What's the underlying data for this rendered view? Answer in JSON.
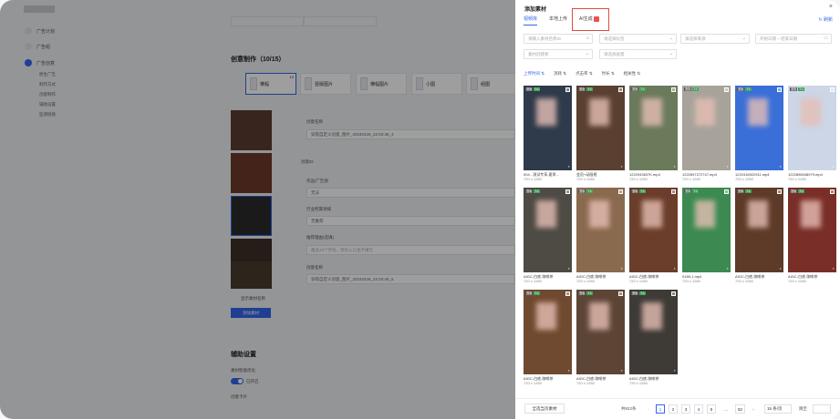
{
  "sidebar": {
    "items": [
      {
        "label": "广告计划"
      },
      {
        "label": "广告组"
      },
      {
        "label": "广告创意"
      }
    ],
    "subitems": [
      "原生广告",
      "制作方式",
      "创意制作",
      "辅助设置",
      "监测链接"
    ]
  },
  "main": {
    "section_creative": "创意制作（10/15）",
    "type_tabs": [
      {
        "label": "横幅",
        "badge": "10"
      },
      {
        "label": "竖版图片"
      },
      {
        "label": "横幅图片"
      },
      {
        "label": "小图"
      },
      {
        "label": "组图"
      }
    ],
    "fields": {
      "creative_name_label": "创意名称",
      "creative_name_value": "穿搭自定义创意_图片_20240426_22:04:45_4",
      "creative_id_label": "创意ID",
      "author_label": "作品/广告源",
      "author_value": "无法",
      "industry_label": "行业所属领域",
      "industry_value": "无推荐",
      "recommend_label": "推荐理由(选填)",
      "recommend_placeholder": "最多20个字符，带有入口也不填写",
      "creative_name2_label": "创意名称",
      "creative_name2_value": "穿搭自定义创意_图片_20240426_22:04:45_5"
    },
    "show_all_label": "显示素材名称",
    "add_material_btn": "添加素材",
    "section_assist": "辅助设置",
    "material_opt_label": "素材智能优化",
    "material_opt_toggle": "已开启",
    "creative_card_label": "创意卡片"
  },
  "drawer": {
    "title": "添加素材",
    "close": "×",
    "tabs": [
      "视频库",
      "本地上传",
      "AI生成"
    ],
    "refresh": "刷新",
    "filters": {
      "search_placeholder": "请输入素材名称ID",
      "material_type": "请选择标签",
      "creator": "请选择来源",
      "date_start": "开始日期",
      "date_to": "~",
      "date_end": "结束日期",
      "material_label": "素材创建者",
      "material_quality": "请选择质量"
    },
    "sorts": [
      "上传时间",
      "消耗",
      "点击率",
      "时长",
      "相关性"
    ],
    "cards": [
      {
        "name": "004 - 测试专享-夏季...",
        "dim": "720 x 1280",
        "tags": [
          "竖版",
          "7:1"
        ],
        "bg": "#2f3a4a"
      },
      {
        "name": "会员+动画视",
        "dim": "720 x 1280",
        "tags": [
          "竖版",
          "7:1"
        ],
        "bg": "#5a4030"
      },
      {
        "name": "1222943637K.mp4",
        "dim": "720 x 1280",
        "tags": [
          "竖版",
          "7:1"
        ],
        "bg": "#6b7a5a"
      },
      {
        "name": "1222697272747.mp4",
        "dim": "720 x 1280",
        "tags": [
          "竖版",
          "7:1"
        ],
        "bg": "#a7a39b"
      },
      {
        "name": "1222416922911.mp4",
        "dim": "720 x 1280",
        "tags": [
          "竖版",
          "7:1"
        ],
        "bg": "#3b6fd8"
      },
      {
        "name": "1222896048979.mp4",
        "dim": "720 x 1280",
        "tags": [
          "竖版",
          "7:1"
        ],
        "bg": "#cdd6e6"
      },
      {
        "name": "AIGC-白底-咖啡茶",
        "dim": "720 x 1280",
        "tags": [
          "竖版",
          "7:1"
        ],
        "bg": "#4e4a44"
      },
      {
        "name": "AIGC-白底-咖啡茶",
        "dim": "720 x 1280",
        "tags": [
          "竖版",
          "7:1"
        ],
        "bg": "#8a6a4f"
      },
      {
        "name": "AIGC-白底-咖啡茶",
        "dim": "720 x 1280",
        "tags": [
          "竖版",
          "7:1"
        ],
        "bg": "#6a3e2a"
      },
      {
        "name": "0165-1.mp4",
        "dim": "720 x 1280",
        "tags": [
          "竖版",
          "7:1"
        ],
        "bg": "#3c8a52"
      },
      {
        "name": "AIGC-白底-咖啡茶",
        "dim": "720 x 1280",
        "tags": [
          "竖版",
          "7:1"
        ],
        "bg": "#5e3a28"
      },
      {
        "name": "AIGC-白底-咖啡茶",
        "dim": "720 x 1280",
        "tags": [
          "竖版",
          "7:1"
        ],
        "bg": "#7a2e28"
      },
      {
        "name": "AIGC-白底-咖啡茶",
        "dim": "720 x 1280",
        "tags": [
          "竖版",
          "7:1"
        ],
        "bg": "#704a30"
      },
      {
        "name": "AIGC-白底-咖啡茶",
        "dim": "720 x 1280",
        "tags": [
          "竖版",
          "7:1"
        ],
        "bg": "#5d4536"
      },
      {
        "name": "AIGC-白底-咖啡茶",
        "dim": "720 x 1280",
        "tags": [
          "竖版",
          "7:1"
        ],
        "bg": "#3e3a36"
      }
    ],
    "footer": {
      "select_all": "全选当页素材",
      "total": "共822条",
      "pages": [
        "1",
        "2",
        "3",
        "4",
        "5",
        "...",
        "82"
      ],
      "prev": "‹",
      "next": "›",
      "page_size": "15 条/页",
      "goto": "跳至"
    }
  }
}
